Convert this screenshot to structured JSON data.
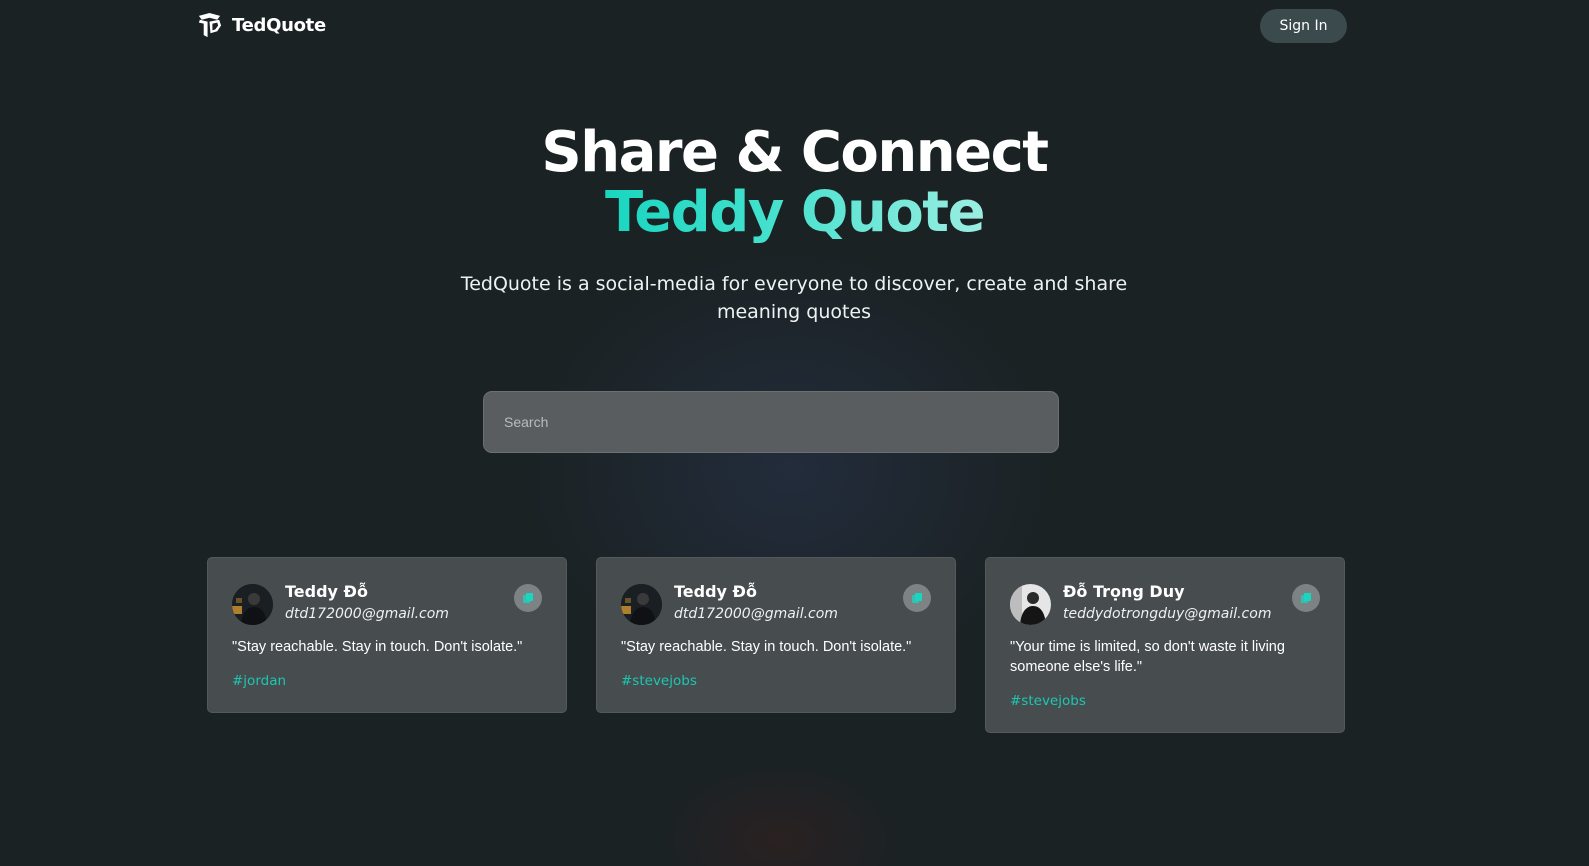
{
  "brand": {
    "name": "TedQuote"
  },
  "nav": {
    "signin_label": "Sign In"
  },
  "hero": {
    "title": "Share & Connect",
    "accent": "Teddy Quote",
    "subtitle": "TedQuote is a social-media for everyone to discover, create and share meaning quotes"
  },
  "search": {
    "placeholder": "Search",
    "value": ""
  },
  "cards": [
    {
      "author": "Teddy Đỗ",
      "email": "dtd172000@gmail.com",
      "quote": "\"Stay reachable. Stay in touch. Don't isolate.\"",
      "tag": "#jordan"
    },
    {
      "author": "Teddy Đỗ",
      "email": "dtd172000@gmail.com",
      "quote": "\"Stay reachable. Stay in touch. Don't isolate.\"",
      "tag": "#stevejobs"
    },
    {
      "author": "Đỗ Trọng Duy",
      "email": "teddydotrongduy@gmail.com",
      "quote": "\"Your time is limited, so don't waste it living someone else's life.\"",
      "tag": "#stevejobs"
    }
  ],
  "icons": {
    "logo": "tedquote-logo-icon",
    "copy": "copy-icon",
    "avatar": "avatar"
  },
  "colors": {
    "background": "#1b2224",
    "accent": "#19d6c0",
    "card": "#474c4f",
    "search": "#595d60",
    "signin": "#3a4a4d"
  }
}
